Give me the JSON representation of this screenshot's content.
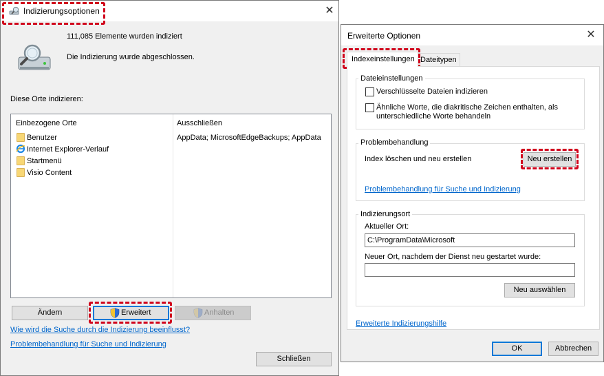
{
  "main_window": {
    "title": "Indizierungsoptionen",
    "status_count": "111,085 Elemente wurden indiziert",
    "status_message": "Die Indizierung wurde abgeschlossen.",
    "section_label": "Diese Orte indizieren:",
    "columns": [
      "Einbezogene Orte",
      "Ausschließen"
    ],
    "locations": [
      {
        "name": "Benutzer",
        "icon": "folder-icon",
        "exclude": "AppData; MicrosoftEdgeBackups; AppData"
      },
      {
        "name": "Internet Explorer-Verlauf",
        "icon": "internet-explorer-icon",
        "exclude": ""
      },
      {
        "name": "Startmenü",
        "icon": "folder-icon",
        "exclude": ""
      },
      {
        "name": "Visio Content",
        "icon": "folder-icon",
        "exclude": ""
      }
    ],
    "buttons": {
      "aendern": "Ändern",
      "erweitert": "Erweitert",
      "anhalten": "Anhalten",
      "schliessen": "Schließen"
    },
    "links": {
      "search_influence": "Wie wird die Suche durch die Indizierung beeinflusst?",
      "troubleshoot": "Problembehandlung für Suche und Indizierung"
    }
  },
  "advanced_window": {
    "title": "Erweiterte Optionen",
    "tabs": [
      {
        "label": "Indexeinstellungen",
        "selected": true
      },
      {
        "label": "Dateitypen",
        "selected": false
      }
    ],
    "file_settings": {
      "legend": "Dateieinstellungen",
      "checkbox_encrypted": "Verschlüsselte Dateien indizieren",
      "checkbox_similar_line1": "Ähnliche Worte, die diakritische Zeichen enthalten, als",
      "checkbox_similar_line2": "unterschiedliche Worte behandeln"
    },
    "troubleshooting": {
      "legend": "Problembehandlung",
      "rebuild_label": "Index löschen und neu erstellen",
      "rebuild_button": "Neu erstellen",
      "link": "Problembehandlung für Suche und Indizierung"
    },
    "index_location": {
      "legend": "Indizierungsort",
      "current_label": "Aktueller Ort:",
      "current_value": "C:\\ProgramData\\Microsoft",
      "new_label": "Neuer Ort, nachdem der Dienst neu gestartet wurde:",
      "new_value": "",
      "select_button": "Neu auswählen"
    },
    "help_link": "Erweiterte Indizierungshilfe",
    "ok_button": "OK",
    "cancel_button": "Abbrechen"
  },
  "colors": {
    "highlight": "#d0021b",
    "link": "#0066cc",
    "window_bg": "#f0f0f0"
  }
}
